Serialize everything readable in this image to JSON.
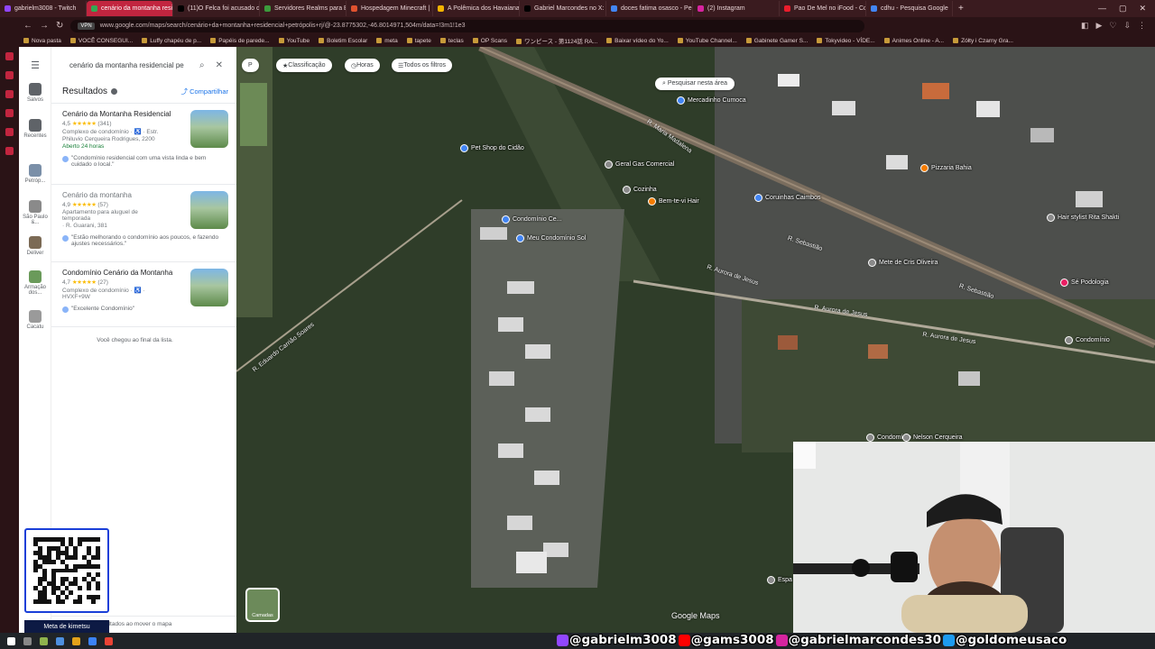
{
  "tabs": [
    {
      "label": "gabrielm3008 - Twitch",
      "color": "#9146ff",
      "active": false
    },
    {
      "label": "cenário da montanha resid",
      "color": "#34a853",
      "active": true
    },
    {
      "label": "(11)O Felca foi acusado de",
      "color": "#000000",
      "active": false
    },
    {
      "label": "Servidores Realms para Be",
      "color": "#3c9a3c",
      "active": false
    },
    {
      "label": "Hospedagem Minecraft | ",
      "color": "#e0522f",
      "active": false
    },
    {
      "label": "A Polêmica dos Havaianas",
      "color": "#f4b400",
      "active": false
    },
    {
      "label": "Gabriel Marcondes no X:",
      "color": "#000000",
      "active": false
    },
    {
      "label": "doces fatima osasco - Pe",
      "color": "#4285f4",
      "active": false
    },
    {
      "label": "(2) Instagram",
      "color": "#d6249f",
      "active": false
    },
    {
      "label": "Pao De Mel no iFood - Co",
      "color": "#ea1d2c",
      "active": false
    },
    {
      "label": "cdhu - Pesquisa Google",
      "color": "#4285f4",
      "active": false
    }
  ],
  "url": "www.google.com/maps/search/cenário+da+montanha+residencial+petrópolis+rj/@-23.8775302,-46.8014971,504m/data=!3m1!1e3",
  "vpn": "VPN",
  "bookmarks": [
    "Nova pasta",
    "VOCÊ CONSEGUI...",
    "Luffy chapéu de p...",
    "Papéis de parede...",
    "YouTube",
    "Boletim Escolar",
    "meta",
    "tapete",
    "teclas",
    "OP Scans",
    "ワンピース - 第1124話 RA...",
    "Baixar vídeo do Yo...",
    "YouTube Channel...",
    "Gabinete Gamer S...",
    "Tokyvideo - VÍDE...",
    "Animes Online - A...",
    "Zółty i Czarny Gra..."
  ],
  "rail": [
    {
      "label": "Salvos",
      "color": "#5f6368"
    },
    {
      "label": "Recentes",
      "color": "#5f6368"
    },
    {
      "label": "Petróp...",
      "color": "#7a8fa8"
    },
    {
      "label": "São Paulo &...",
      "color": "#8a8a8a"
    },
    {
      "label": "Deliver",
      "color": "#7b6a55"
    },
    {
      "label": "Armação dos...",
      "color": "#6a9a5a"
    },
    {
      "label": "Cacatu",
      "color": "#9a9a9a"
    }
  ],
  "search": {
    "value": "cenário da montanha residencial pe"
  },
  "results_header": {
    "title": "Resultados",
    "share": "Compartilhar"
  },
  "results": [
    {
      "name": "Cenário da Montanha Residencial",
      "rating": "4,5",
      "stars": "★★★★★",
      "count": "(341)",
      "line1": "Complexo de condomínio · ♿ · Estr.",
      "line2": "Philuvio Cerqueira Rodrigues, 2200",
      "status": "Aberto 24 horas",
      "review": "\"Condomínio residencial com uma vista linda e bem cuidado o local.\""
    },
    {
      "name": "Cenário da montanha",
      "rating": "4,9",
      "stars": "★★★★★",
      "count": "(57)",
      "line1": "Apartamento para aluguel de temporada",
      "line2": "· R. Guarani, 381",
      "status": "",
      "review": "\"Estão melhorando o condomínio aos poucos, e fazendo ajustes necessários.\""
    },
    {
      "name": "Condomínio Cenário da Montanha",
      "rating": "4,7",
      "stars": "★★★★★",
      "count": "(27)",
      "line1": "Complexo de condomínio · ♿ · HVXF+9W",
      "line2": "",
      "status": "",
      "review": "\"Excelente Condomínio\""
    }
  ],
  "end_of_list": "Você chegou ao final da lista.",
  "footer_text": "ultados ao mover o mapa",
  "qr_caption": "Meta de kimetsu",
  "map": {
    "chips": [
      "Classificação",
      "Horas",
      "Todos os filtros"
    ],
    "search_area": "Pesquisar nesta área",
    "labels": [
      "Pet Shop do Cidão",
      "Condomínio Ce...",
      "Meu Condomínio Sol",
      "Geral Gas Comercial",
      "Pizzaria Bahia",
      "Bem-te-vi Hair",
      "Mercadinho Cumoca",
      "Coruinhas Caimbos",
      "Mete de Cris Oliveira",
      "Condomínio",
      "Sé Podologia",
      "Condomínio",
      "Nelson Cerqueira",
      "Espa",
      "Cozinha",
      "Hair stylist Rita Shakti"
    ],
    "roads": [
      "R. Eduardo Carrião Soares",
      "R. Aurora de Jesus",
      "R. Aurora de Jesus",
      "R. Aurora de Jesus",
      "R. Sebastião",
      "R. Sebastião",
      "R. Maria Madalena"
    ],
    "layers": "Camadas",
    "brand": "Google Maps"
  },
  "socials": [
    {
      "handle": "gabrielm3008",
      "color": "#9146ff"
    },
    {
      "handle": "gams3008",
      "color": "#ff0000"
    },
    {
      "handle": "gabrielmarcondes30",
      "color": "#d6249f"
    },
    {
      "handle": "goldomeusaco",
      "color": "#1d9bf0"
    }
  ]
}
